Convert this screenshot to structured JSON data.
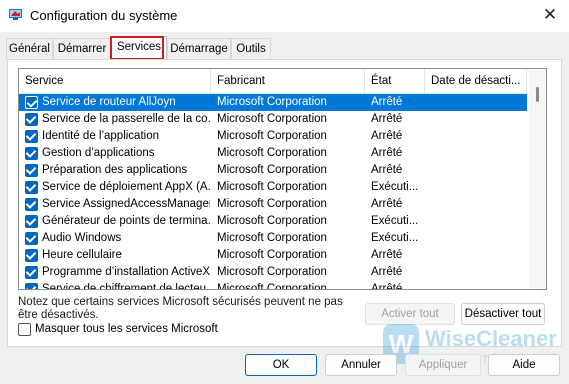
{
  "window": {
    "title": "Configuration du système",
    "close_icon": "✕"
  },
  "tabs": [
    {
      "label": "Général",
      "active": false
    },
    {
      "label": "Démarrer",
      "active": false
    },
    {
      "label": "Services",
      "active": true
    },
    {
      "label": "Démarrage",
      "active": false
    },
    {
      "label": "Outils",
      "active": false
    }
  ],
  "list": {
    "columns": [
      "Service",
      "Fabricant",
      "État",
      "Date de désacti..."
    ],
    "rows": [
      {
        "name": "Service de routeur AllJoyn",
        "maker": "Microsoft Corporation",
        "state": "Arrêté",
        "date": "",
        "checked": true,
        "selected": true
      },
      {
        "name": "Service de la passerelle de la co...",
        "maker": "Microsoft Corporation",
        "state": "Arrêté",
        "date": "",
        "checked": true,
        "selected": false
      },
      {
        "name": "Identité de l’application",
        "maker": "Microsoft Corporation",
        "state": "Arrêté",
        "date": "",
        "checked": true,
        "selected": false
      },
      {
        "name": "Gestion d’applications",
        "maker": "Microsoft Corporation",
        "state": "Arrêté",
        "date": "",
        "checked": true,
        "selected": false
      },
      {
        "name": "Préparation des applications",
        "maker": "Microsoft Corporation",
        "state": "Arrêté",
        "date": "",
        "checked": true,
        "selected": false
      },
      {
        "name": "Service de déploiement AppX (A...",
        "maker": "Microsoft Corporation",
        "state": "Exécuti...",
        "date": "",
        "checked": true,
        "selected": false
      },
      {
        "name": "Service AssignedAccessManager",
        "maker": "Microsoft Corporation",
        "state": "Arrêté",
        "date": "",
        "checked": true,
        "selected": false
      },
      {
        "name": "Générateur de points de termina...",
        "maker": "Microsoft Corporation",
        "state": "Exécuti...",
        "date": "",
        "checked": true,
        "selected": false
      },
      {
        "name": "Audio Windows",
        "maker": "Microsoft Corporation",
        "state": "Exécuti...",
        "date": "",
        "checked": true,
        "selected": false
      },
      {
        "name": "Heure cellulaire",
        "maker": "Microsoft Corporation",
        "state": "Arrêté",
        "date": "",
        "checked": true,
        "selected": false
      },
      {
        "name": "Programme d’installation ActiveX...",
        "maker": "Microsoft Corporation",
        "state": "Arrêté",
        "date": "",
        "checked": true,
        "selected": false
      },
      {
        "name": "Service de chiffrement de lecteu...",
        "maker": "Microsoft Corporation",
        "state": "Arrêté",
        "date": "",
        "checked": true,
        "selected": false
      }
    ]
  },
  "note": "Notez que certains services Microsoft sécurisés peuvent ne pas être désactivés.",
  "buttons": {
    "enable_all": "Activer tout",
    "disable_all": "Désactiver tout",
    "hide_ms": "Masquer tous les services Microsoft",
    "ok": "OK",
    "cancel": "Annuler",
    "apply": "Appliquer",
    "help": "Aide"
  },
  "watermark": {
    "name": "WiseCleaner",
    "tagline": "Advanced PC Tune-up Utilities"
  },
  "colors": {
    "accent": "#0067c0",
    "selection": "#0078d7",
    "highlight": "#d21c1c"
  }
}
